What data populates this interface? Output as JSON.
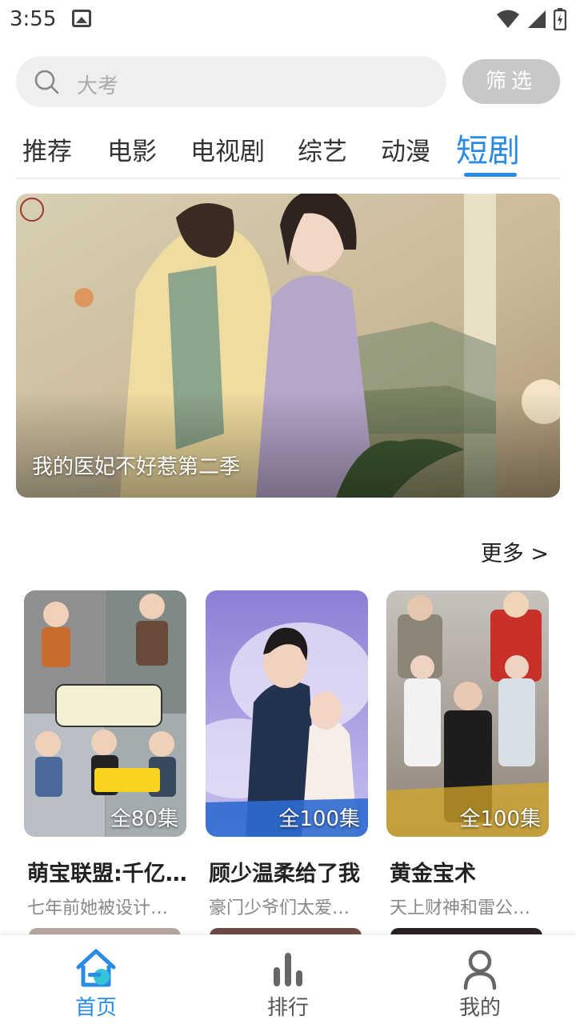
{
  "status_bar": {
    "time": "3:55"
  },
  "search": {
    "placeholder": "大考",
    "filter_label": "筛选"
  },
  "tabs": [
    {
      "label": "推荐",
      "active": false
    },
    {
      "label": "电影",
      "active": false
    },
    {
      "label": "电视剧",
      "active": false
    },
    {
      "label": "综艺",
      "active": false
    },
    {
      "label": "动漫",
      "active": false
    },
    {
      "label": "短剧",
      "active": true
    }
  ],
  "banner": {
    "title": "我的医妃不好惹第二季"
  },
  "section": {
    "more_label": "更多 >"
  },
  "cards": [
    {
      "title": "萌宝联盟:千亿…",
      "desc": "七年前她被设计…",
      "episodes": "全80集"
    },
    {
      "title": "顾少温柔给了我",
      "desc": "豪门少爷们太爱…",
      "episodes": "全100集"
    },
    {
      "title": "黄金宝术",
      "desc": "天上财神和雷公…",
      "episodes": "全100集"
    }
  ],
  "bottom_nav": [
    {
      "label": "首页",
      "icon": "home-icon",
      "active": true
    },
    {
      "label": "排行",
      "icon": "ranking-icon",
      "active": false
    },
    {
      "label": "我的",
      "icon": "profile-icon",
      "active": false
    }
  ],
  "colors": {
    "accent": "#2a8be4",
    "filter_bg": "#c8c8c8",
    "search_bg": "#efefef"
  }
}
